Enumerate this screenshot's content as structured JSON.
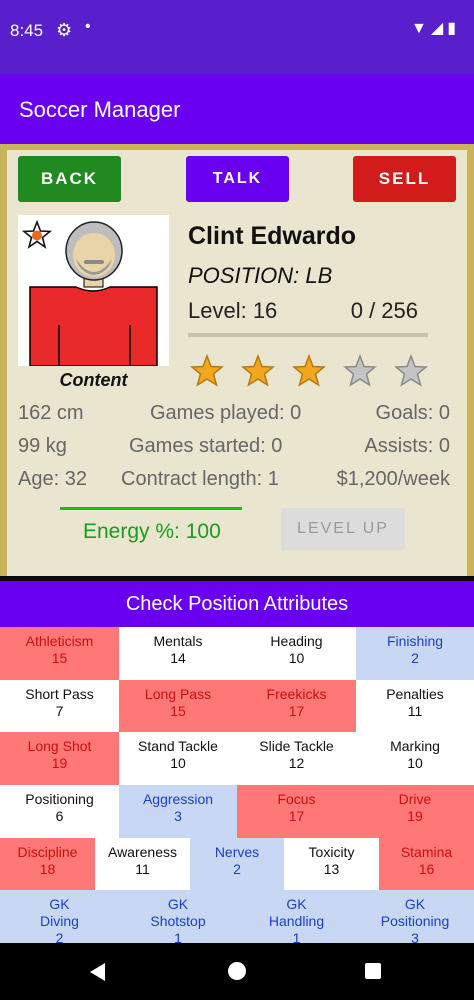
{
  "status_bar": {
    "time": "8:45"
  },
  "app": {
    "title": "Soccer Manager"
  },
  "buttons": {
    "back": "BACK",
    "talk": "TALK",
    "sell": "SELL",
    "level_up": "LEVEL UP"
  },
  "player": {
    "name": "Clint Edwardo",
    "position": "POSITION: LB",
    "level": "Level: 16",
    "xp": "0 / 256",
    "mood": "Content",
    "star_rating": 3,
    "star_max": 5,
    "height": "162 cm",
    "weight": "99 kg",
    "age": "Age: 32",
    "games_played": "Games played: 0",
    "games_started": "Games started: 0",
    "contract_length": "Contract length: 1",
    "goals": "Goals: 0",
    "assists": "Assists: 0",
    "wage": "$1,200/week",
    "energy": "Energy %: 100",
    "energy_level": 1.0
  },
  "attributes": {
    "header": "Check Position Attributes",
    "rows": [
      [
        {
          "label": "Athleticism",
          "value": "15",
          "color": "red"
        },
        {
          "label": "Mentals",
          "value": "14",
          "color": "white"
        },
        {
          "label": "Heading",
          "value": "10",
          "color": "white"
        },
        {
          "label": "Finishing",
          "value": "2",
          "color": "blue"
        }
      ],
      [
        {
          "label": "Short Pass",
          "value": "7",
          "color": "white"
        },
        {
          "label": "Long Pass",
          "value": "15",
          "color": "red"
        },
        {
          "label": "Freekicks",
          "value": "17",
          "color": "red"
        },
        {
          "label": "Penalties",
          "value": "11",
          "color": "white"
        }
      ],
      [
        {
          "label": "Long Shot",
          "value": "19",
          "color": "red"
        },
        {
          "label": "Stand Tackle",
          "value": "10",
          "color": "white"
        },
        {
          "label": "Slide Tackle",
          "value": "12",
          "color": "white"
        },
        {
          "label": "Marking",
          "value": "10",
          "color": "white"
        }
      ],
      [
        {
          "label": "Positioning",
          "value": "6",
          "color": "white"
        },
        {
          "label": "Aggression",
          "value": "3",
          "color": "blue"
        },
        {
          "label": "Focus",
          "value": "17",
          "color": "red"
        },
        {
          "label": "Drive",
          "value": "19",
          "color": "red"
        }
      ],
      [
        {
          "label": "Discipline",
          "value": "18",
          "color": "red"
        },
        {
          "label": "Awareness",
          "value": "11",
          "color": "white"
        },
        {
          "label": "Nerves",
          "value": "2",
          "color": "blue"
        },
        {
          "label": "Toxicity",
          "value": "13",
          "color": "white"
        },
        {
          "label": "Stamina",
          "value": "16",
          "color": "red"
        }
      ],
      [
        {
          "label": "GK\nDiving",
          "value": "2",
          "color": "blue"
        },
        {
          "label": "GK\nShotstop",
          "value": "1",
          "color": "blue"
        },
        {
          "label": "GK\nHandling",
          "value": "1",
          "color": "blue"
        },
        {
          "label": "GK\nPositioning",
          "value": "3",
          "color": "blue"
        }
      ]
    ]
  },
  "colors": {
    "primary": "#6a00f0",
    "status_bar": "#5a1fcc",
    "back_button": "#208a20",
    "sell_button": "#d21c1c",
    "card_border": "#c8b25a",
    "card_bg": "#e9e5cf",
    "energy": "#16c016",
    "attr_red": "#ff7878",
    "attr_blue": "#c8d8f4"
  }
}
